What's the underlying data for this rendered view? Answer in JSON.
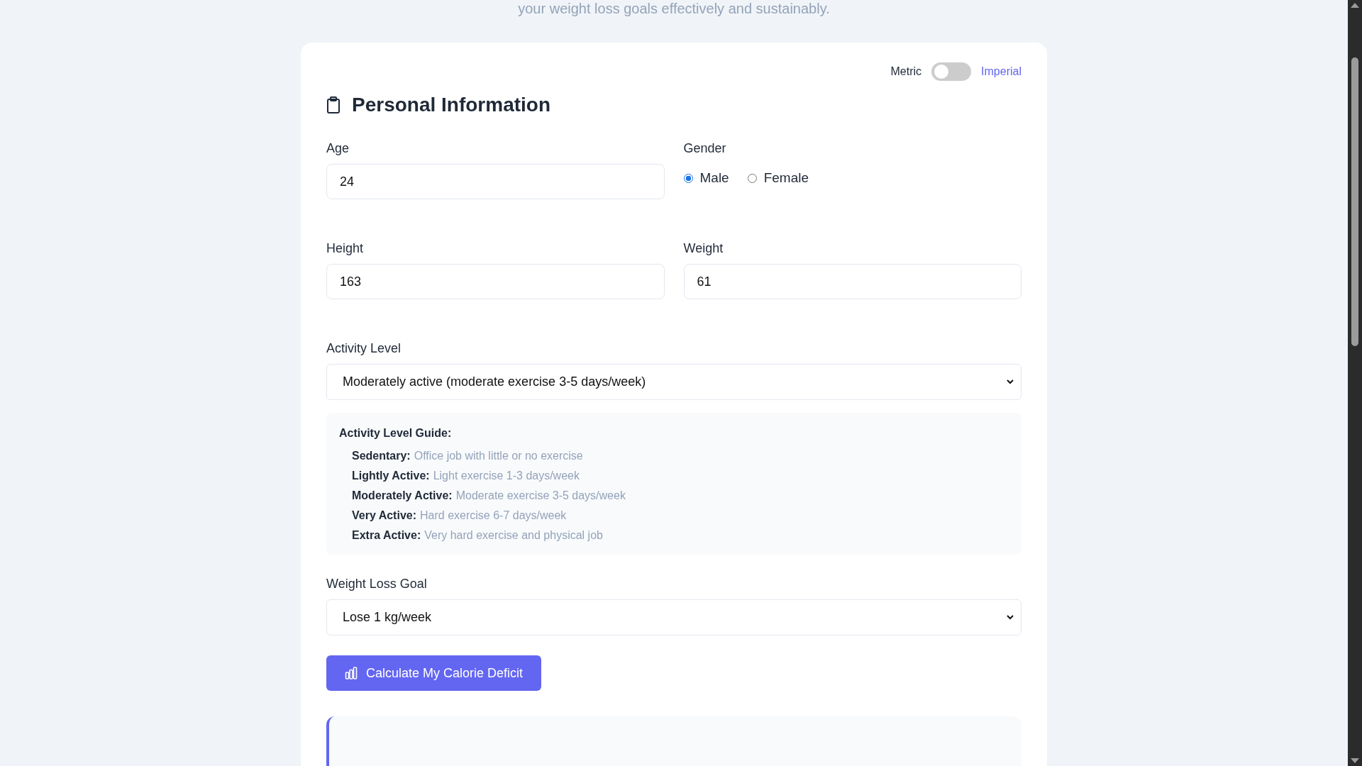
{
  "subtitle": "your weight loss goals effectively and sustainably.",
  "unit_toggle": {
    "left_label": "Metric",
    "right_label": "Imperial",
    "on": false
  },
  "section": {
    "title": "Personal Information"
  },
  "age": {
    "label": "Age",
    "value": "24"
  },
  "gender": {
    "label": "Gender",
    "options": [
      {
        "label": "Male",
        "selected": true
      },
      {
        "label": "Female",
        "selected": false
      }
    ]
  },
  "height": {
    "label": "Height",
    "value": "163"
  },
  "weight": {
    "label": "Weight",
    "value": "61"
  },
  "activity": {
    "label": "Activity Level",
    "value": "Moderately active (moderate exercise 3-5 days/week)"
  },
  "guide": {
    "title": "Activity Level Guide:",
    "items": [
      {
        "term": "Sedentary:",
        "description": "Office job with little or no exercise"
      },
      {
        "term": "Lightly Active:",
        "description": "Light exercise 1-3 days/week"
      },
      {
        "term": "Moderately Active:",
        "description": "Moderate exercise 3-5 days/week"
      },
      {
        "term": "Very Active:",
        "description": "Hard exercise 6-7 days/week"
      },
      {
        "term": "Extra Active:",
        "description": "Very hard exercise and physical job"
      }
    ]
  },
  "goal": {
    "label": "Weight Loss Goal",
    "value": "Lose 1 kg/week"
  },
  "calculate_button": {
    "label": "Calculate My Calorie Deficit"
  }
}
